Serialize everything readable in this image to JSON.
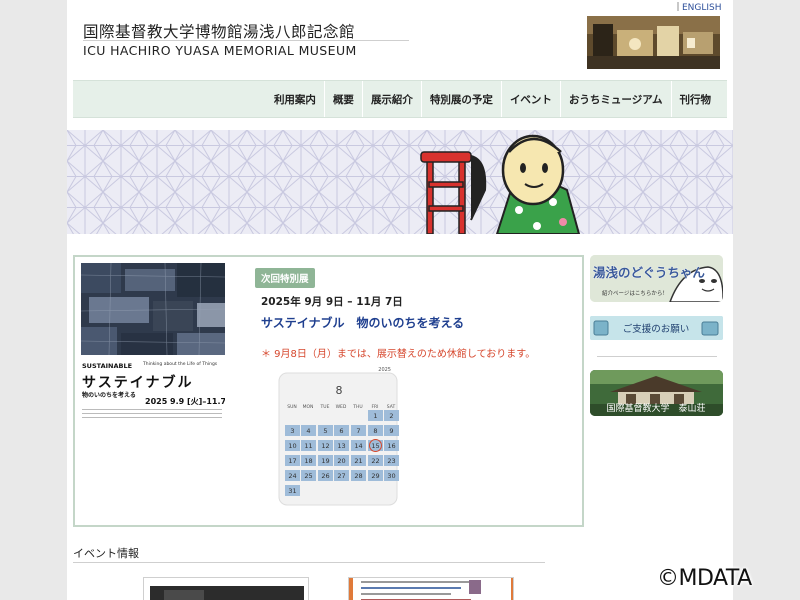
{
  "header": {
    "title_ja": "国際基督教大学博物館湯浅八郎記念館",
    "title_en": "ICU HACHIRO YUASA MEMORIAL MUSEUM",
    "english_link": "ENGLISH"
  },
  "nav": {
    "items": [
      {
        "label": "利用案内"
      },
      {
        "label": "概要"
      },
      {
        "label": "展示紹介"
      },
      {
        "label": "特別展の予定"
      },
      {
        "label": "イベント"
      },
      {
        "label": "おうちミュージアム"
      },
      {
        "label": "刊行物"
      }
    ]
  },
  "exhibition": {
    "tag": "次回特別展",
    "dates": "2025年 9月 9日 – 11月 7日",
    "title": "サステイナブル　物のいのちを考える",
    "notice": "＊ 9月8日（月）までは、展示替えのため休館しております。",
    "poster": {
      "title_en": "SUSTAINABLE",
      "subtitle_en": "Thinking about the Life of Things",
      "title_ja": "サステイナブル",
      "subtitle_ja": "物のいのちを考える",
      "dates": "2025 9.9 [火]–11.7 [金]"
    }
  },
  "calendar": {
    "year": "2025",
    "month": "8",
    "weekdays": [
      "SUN",
      "MON",
      "TUE",
      "WED",
      "THU",
      "FRI",
      "SAT"
    ],
    "weeks": [
      [
        "",
        "",
        "",
        "",
        "",
        "1",
        "2"
      ],
      [
        "3",
        "4",
        "5",
        "6",
        "7",
        "8",
        "9"
      ],
      [
        "10",
        "11",
        "12",
        "13",
        "14",
        "15",
        "16"
      ],
      [
        "17",
        "18",
        "19",
        "20",
        "21",
        "22",
        "23"
      ],
      [
        "24",
        "25",
        "26",
        "27",
        "28",
        "29",
        "30"
      ],
      [
        "31",
        "",
        "",
        "",
        "",
        "",
        ""
      ]
    ],
    "highlighted_day": "15"
  },
  "sidebar": {
    "banner1_title": "湯浅のどぐうちゃん",
    "banner1_sub": "紹介ページはこちらから！",
    "banner2_label": "ご支援のお願い",
    "banner3_label": "国際基督教大学　泰山荘"
  },
  "events": {
    "title": "イベント情報"
  },
  "copyright": "©MDATA",
  "colors": {
    "nav_bg": "#e6f0e9",
    "tag_bg": "#8fb596",
    "title_blue": "#1f3f8f",
    "notice_red": "#d6472d",
    "calendar_blue": "#9fbcd9"
  }
}
